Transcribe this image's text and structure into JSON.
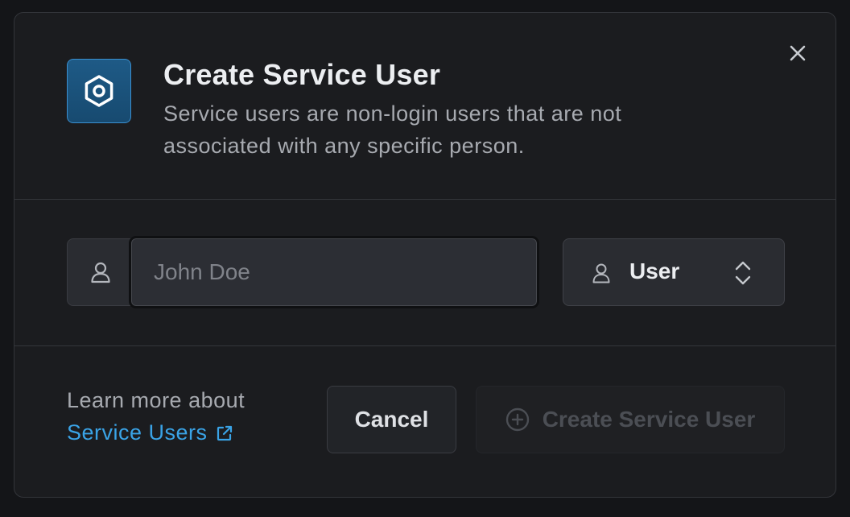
{
  "dialog": {
    "title": "Create Service User",
    "description": "Service users are non-login users that are not associated with any specific person.",
    "icon": "hexagon-service-icon",
    "close_icon": "close-icon"
  },
  "form": {
    "name_input": {
      "placeholder": "John Doe",
      "value": "",
      "icon": "user-icon"
    },
    "role_select": {
      "selected": "User",
      "icon": "user-icon",
      "chevron": "chevron-up-down-icon"
    }
  },
  "footer": {
    "learn_more_text": "Learn more about",
    "learn_more_link": "Service Users",
    "link_icon": "external-link-icon",
    "cancel_label": "Cancel",
    "create_label": "Create Service User",
    "create_icon": "plus-circle-icon",
    "create_disabled": true
  },
  "colors": {
    "accent_link": "#3aa3e6",
    "icon_bg": "#1e5a86",
    "modal_bg": "#1b1c1f"
  }
}
